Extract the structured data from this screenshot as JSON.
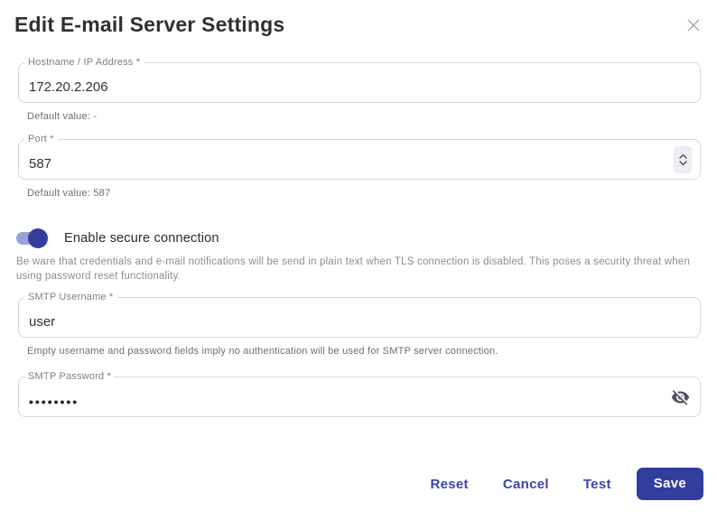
{
  "header": {
    "title": "Edit E-mail Server Settings",
    "close_glyph": "✕"
  },
  "fields": {
    "hostname": {
      "label": "Hostname / IP Address *",
      "value": "172.20.2.206",
      "helper": "Default value: -"
    },
    "port": {
      "label": "Port *",
      "value": "587",
      "helper": "Default value: 587"
    },
    "secure_connection": {
      "label": "Enable secure connection",
      "state": "on",
      "warning": "Be ware that credentials and e-mail notifications will be send in plain text when TLS connection is disabled. This poses a security threat when using password reset functionality."
    },
    "smtp_username": {
      "label": "SMTP Username *",
      "value": "user",
      "helper": "Empty username and password fields imply no authentication will be used for SMTP server connection."
    },
    "smtp_password": {
      "label": "SMTP Password *",
      "value": "••••••••"
    }
  },
  "footer": {
    "reset_label": "Reset",
    "cancel_label": "Cancel",
    "test_label": "Test",
    "save_label": "Save"
  },
  "icons": {
    "close": "close-icon",
    "stepper": "number-stepper-icon",
    "visibility": "visibility-off-icon"
  },
  "colors": {
    "accent": "#333d9d",
    "accent_light": "#9aa2d8",
    "text_button": "#3a45a9",
    "input_border": "#d8d8d8"
  }
}
